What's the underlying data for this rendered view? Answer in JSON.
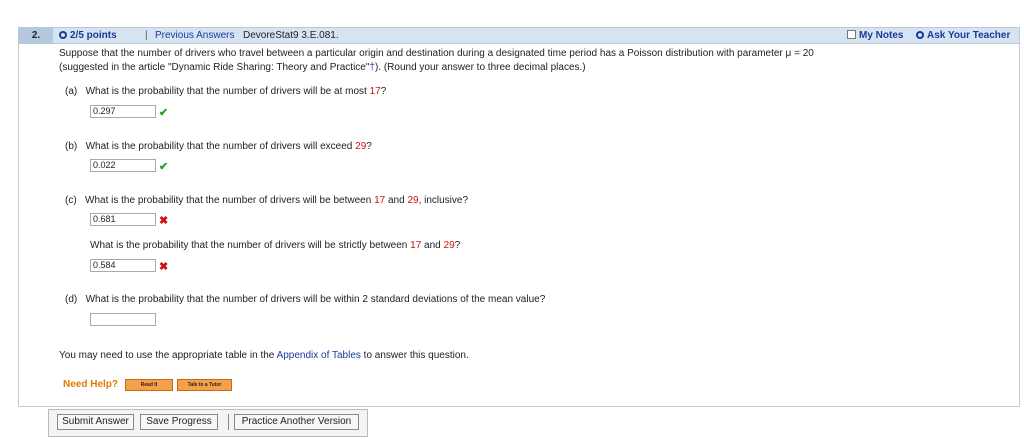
{
  "header": {
    "question_number": "2.",
    "points": "2/5 points",
    "separator": "|",
    "previous_answers": "Previous Answers",
    "problem_code": "DevoreStat9 3.E.081.",
    "my_notes": "My Notes",
    "ask_teacher": "Ask Your Teacher"
  },
  "intro": {
    "line1_a": "Suppose that the number of drivers who travel between a particular origin and destination during a designated time period has a Poisson distribution with parameter ",
    "mu": "μ = 20",
    "line2_a": "(suggested in the article \"Dynamic Ride Sharing: Theory and Practice\"",
    "dagger": "†",
    "line2_b": "). (Round your answer to three decimal places.)"
  },
  "parts": {
    "a": {
      "label": "(a)",
      "q1": "What is the probability that the number of drivers will be at most ",
      "n1": "17",
      "end": "?",
      "answer": "0.297",
      "status": "✔"
    },
    "b": {
      "label": "(b)",
      "q1": "What is the probability that the number of drivers will exceed ",
      "n1": "29",
      "end": "?",
      "answer": "0.022",
      "status": "✔"
    },
    "c": {
      "label": "(c)",
      "q1": "What is the probability that the number of drivers will be between ",
      "n1": "17",
      "mid": " and ",
      "n2": "29",
      "end": ", inclusive?",
      "answer": "0.681",
      "status": "✖"
    },
    "c2": {
      "q1": "What is the probability that the number of drivers will be strictly between ",
      "n1": "17",
      "mid": " and ",
      "n2": "29",
      "end": "?",
      "answer": "0.584",
      "status": "✖"
    },
    "d": {
      "label": "(d)",
      "q1": "What is the probability that the number of drivers will be within 2 standard deviations of the mean value?",
      "answer": ""
    }
  },
  "appendix": {
    "pre": "You may need to use the appropriate table in the ",
    "link": "Appendix of Tables",
    "post": " to answer this question."
  },
  "help": {
    "label": "Need Help?",
    "read_it": "Read It",
    "talk_tutor": "Talk to a Tutor"
  },
  "buttons": {
    "submit": "Submit Answer",
    "save": "Save Progress",
    "practice": "Practice Another Version"
  }
}
